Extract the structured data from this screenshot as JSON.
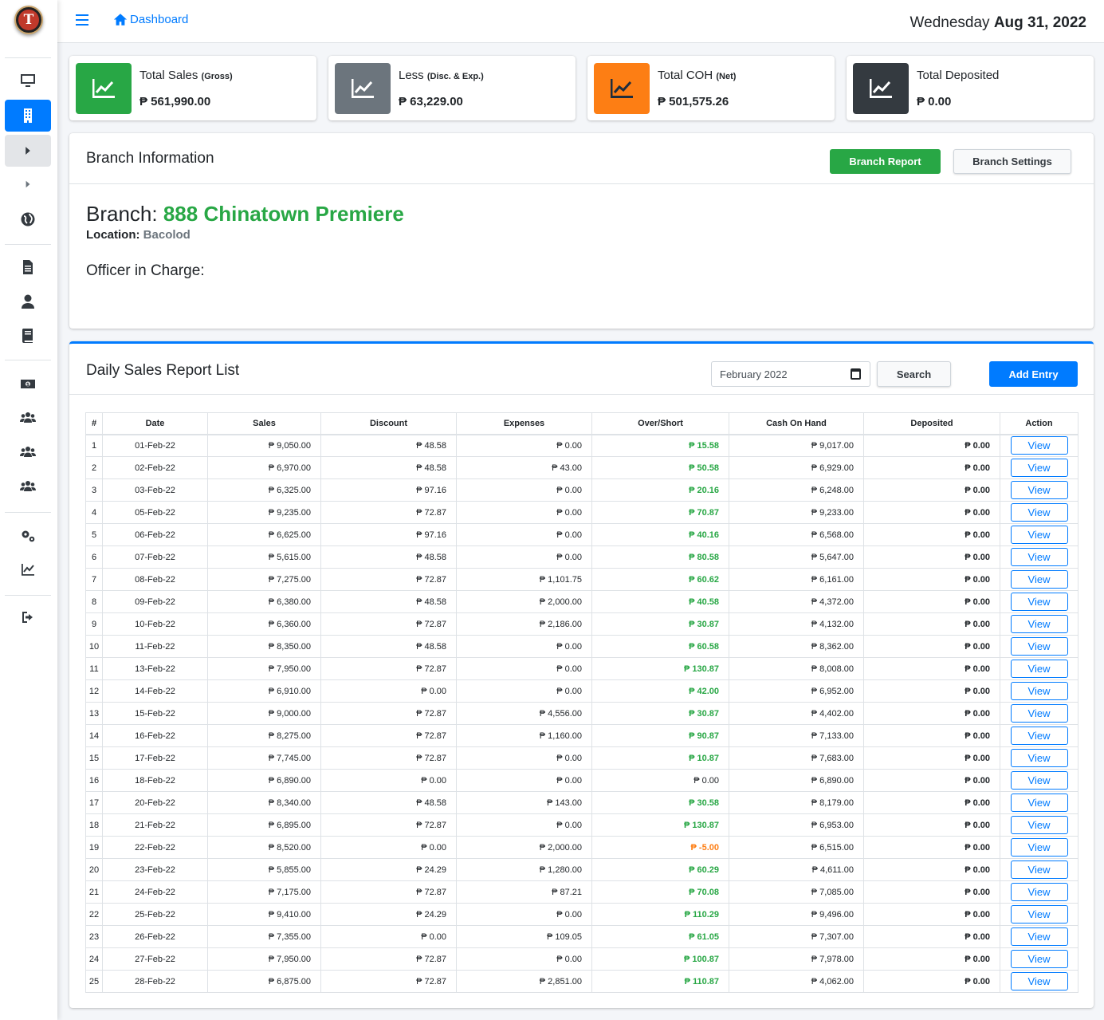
{
  "brand": {
    "logo_letter": "T"
  },
  "navbar": {
    "dashboard_label": "Dashboard",
    "date_weekday": "Wednesday",
    "date_value": "Aug 31, 2022"
  },
  "sidebar": {
    "items": [
      {
        "icon": "desktop-icon"
      },
      {
        "icon": "building-icon",
        "active": true
      },
      {
        "icon": "caret-right-icon"
      },
      {
        "icon": "caret-right-icon"
      },
      {
        "icon": "globe-icon"
      },
      {
        "icon": "file-icon"
      },
      {
        "icon": "user-icon"
      },
      {
        "icon": "book-icon"
      },
      {
        "icon": "money-icon"
      },
      {
        "icon": "users-icon"
      },
      {
        "icon": "users-icon"
      },
      {
        "icon": "users-icon"
      },
      {
        "icon": "cogs-icon"
      },
      {
        "icon": "chart-line-icon"
      },
      {
        "icon": "sign-out-icon"
      }
    ]
  },
  "info_boxes": [
    {
      "label": "Total Sales",
      "sub": "(Gross)",
      "value": "₱ 561,990.00",
      "color": "#28a745"
    },
    {
      "label": "Less",
      "sub": "(Disc. & Exp.)",
      "value": "₱ 63,229.00",
      "color": "#6c757d"
    },
    {
      "label": "Total COH",
      "sub": "(Net)",
      "value": "₱ 501,575.26",
      "color": "#fd7e14"
    },
    {
      "label": "Total Deposited",
      "sub": "",
      "value": "₱ 0.00",
      "color": "#343a40"
    }
  ],
  "branch_card": {
    "title": "Branch Information",
    "report_button": "Branch Report",
    "settings_button": "Branch Settings",
    "branch_label": "Branch:",
    "branch_name": "888 Chinatown Premiere",
    "location_label": "Location:",
    "location_value": "Bacolod",
    "officer_label": "Officer in Charge:"
  },
  "sales_card": {
    "title": "Daily Sales Report List",
    "month_value": "February 2022",
    "search_button": "Search",
    "add_button": "Add Entry",
    "columns": [
      "#",
      "Date",
      "Sales",
      "Discount",
      "Expenses",
      "Over/Short",
      "Cash On Hand",
      "Deposited",
      "Action"
    ],
    "view_label": "View",
    "rows": [
      [
        "1",
        "01-Feb-22",
        "₱ 9,050.00",
        "₱ 48.58",
        "₱ 0.00",
        "₱ 15.58",
        "₱ 9,017.00",
        "₱ 0.00"
      ],
      [
        "2",
        "02-Feb-22",
        "₱ 6,970.00",
        "₱ 48.58",
        "₱ 43.00",
        "₱ 50.58",
        "₱ 6,929.00",
        "₱ 0.00"
      ],
      [
        "3",
        "03-Feb-22",
        "₱ 6,325.00",
        "₱ 97.16",
        "₱ 0.00",
        "₱ 20.16",
        "₱ 6,248.00",
        "₱ 0.00"
      ],
      [
        "4",
        "05-Feb-22",
        "₱ 9,235.00",
        "₱ 72.87",
        "₱ 0.00",
        "₱ 70.87",
        "₱ 9,233.00",
        "₱ 0.00"
      ],
      [
        "5",
        "06-Feb-22",
        "₱ 6,625.00",
        "₱ 97.16",
        "₱ 0.00",
        "₱ 40.16",
        "₱ 6,568.00",
        "₱ 0.00"
      ],
      [
        "6",
        "07-Feb-22",
        "₱ 5,615.00",
        "₱ 48.58",
        "₱ 0.00",
        "₱ 80.58",
        "₱ 5,647.00",
        "₱ 0.00"
      ],
      [
        "7",
        "08-Feb-22",
        "₱ 7,275.00",
        "₱ 72.87",
        "₱ 1,101.75",
        "₱ 60.62",
        "₱ 6,161.00",
        "₱ 0.00"
      ],
      [
        "8",
        "09-Feb-22",
        "₱ 6,380.00",
        "₱ 48.58",
        "₱ 2,000.00",
        "₱ 40.58",
        "₱ 4,372.00",
        "₱ 0.00"
      ],
      [
        "9",
        "10-Feb-22",
        "₱ 6,360.00",
        "₱ 72.87",
        "₱ 2,186.00",
        "₱ 30.87",
        "₱ 4,132.00",
        "₱ 0.00"
      ],
      [
        "10",
        "11-Feb-22",
        "₱ 8,350.00",
        "₱ 48.58",
        "₱ 0.00",
        "₱ 60.58",
        "₱ 8,362.00",
        "₱ 0.00"
      ],
      [
        "11",
        "13-Feb-22",
        "₱ 7,950.00",
        "₱ 72.87",
        "₱ 0.00",
        "₱ 130.87",
        "₱ 8,008.00",
        "₱ 0.00"
      ],
      [
        "12",
        "14-Feb-22",
        "₱ 6,910.00",
        "₱ 0.00",
        "₱ 0.00",
        "₱ 42.00",
        "₱ 6,952.00",
        "₱ 0.00"
      ],
      [
        "13",
        "15-Feb-22",
        "₱ 9,000.00",
        "₱ 72.87",
        "₱ 4,556.00",
        "₱ 30.87",
        "₱ 4,402.00",
        "₱ 0.00"
      ],
      [
        "14",
        "16-Feb-22",
        "₱ 8,275.00",
        "₱ 72.87",
        "₱ 1,160.00",
        "₱ 90.87",
        "₱ 7,133.00",
        "₱ 0.00"
      ],
      [
        "15",
        "17-Feb-22",
        "₱ 7,745.00",
        "₱ 72.87",
        "₱ 0.00",
        "₱ 10.87",
        "₱ 7,683.00",
        "₱ 0.00"
      ],
      [
        "16",
        "18-Feb-22",
        "₱ 6,890.00",
        "₱ 0.00",
        "₱ 0.00",
        "₱ 0.00",
        "₱ 6,890.00",
        "₱ 0.00"
      ],
      [
        "17",
        "20-Feb-22",
        "₱ 8,340.00",
        "₱ 48.58",
        "₱ 143.00",
        "₱ 30.58",
        "₱ 8,179.00",
        "₱ 0.00"
      ],
      [
        "18",
        "21-Feb-22",
        "₱ 6,895.00",
        "₱ 72.87",
        "₱ 0.00",
        "₱ 130.87",
        "₱ 6,953.00",
        "₱ 0.00"
      ],
      [
        "19",
        "22-Feb-22",
        "₱ 8,520.00",
        "₱ 0.00",
        "₱ 2,000.00",
        "₱ -5.00",
        "₱ 6,515.00",
        "₱ 0.00"
      ],
      [
        "20",
        "23-Feb-22",
        "₱ 5,855.00",
        "₱ 24.29",
        "₱ 1,280.00",
        "₱ 60.29",
        "₱ 4,611.00",
        "₱ 0.00"
      ],
      [
        "21",
        "24-Feb-22",
        "₱ 7,175.00",
        "₱ 72.87",
        "₱ 87.21",
        "₱ 70.08",
        "₱ 7,085.00",
        "₱ 0.00"
      ],
      [
        "22",
        "25-Feb-22",
        "₱ 9,410.00",
        "₱ 24.29",
        "₱ 0.00",
        "₱ 110.29",
        "₱ 9,496.00",
        "₱ 0.00"
      ],
      [
        "23",
        "26-Feb-22",
        "₱ 7,355.00",
        "₱ 0.00",
        "₱ 109.05",
        "₱ 61.05",
        "₱ 7,307.00",
        "₱ 0.00"
      ],
      [
        "24",
        "27-Feb-22",
        "₱ 7,950.00",
        "₱ 72.87",
        "₱ 0.00",
        "₱ 100.87",
        "₱ 7,978.00",
        "₱ 0.00"
      ],
      [
        "25",
        "28-Feb-22",
        "₱ 6,875.00",
        "₱ 72.87",
        "₱ 2,851.00",
        "₱ 110.87",
        "₱ 4,062.00",
        "₱ 0.00"
      ]
    ]
  }
}
